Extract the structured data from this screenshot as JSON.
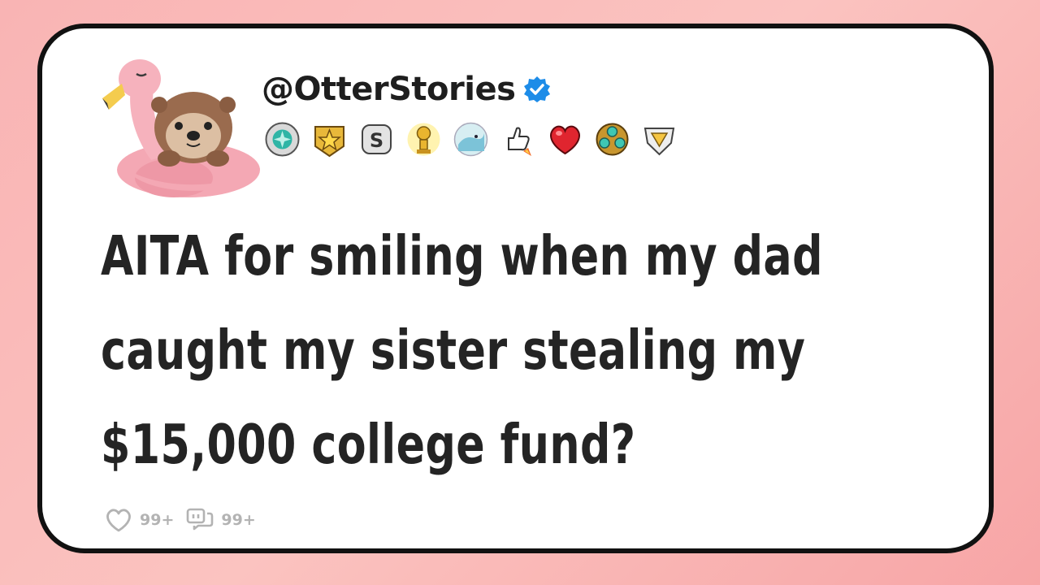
{
  "post": {
    "handle": "@OtterStories",
    "title_lines": [
      "AITA for smiling when my dad",
      "caught my sister stealing my",
      "$15,000 college fund?"
    ],
    "likes": "99+",
    "comments": "99+"
  },
  "badges": [
    "gem-shield-badge",
    "gold-star-badge",
    "silver-s-badge",
    "gold-trophy-badge",
    "wave-face-badge",
    "thumbs-up-rocket-badge",
    "heart-badge",
    "gem-cluster-badge",
    "diamond-shield-badge"
  ],
  "colors": {
    "background": "#f9b4b4",
    "card": "#ffffff",
    "border": "#111111",
    "text": "#242424",
    "verified": "#1d8ce8",
    "stats": "#b3b3b3"
  }
}
